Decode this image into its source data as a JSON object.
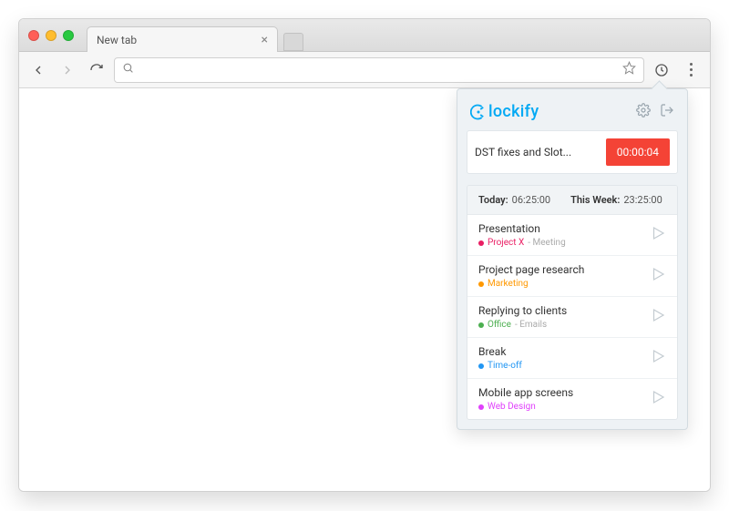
{
  "browser": {
    "tab_title": "New tab",
    "omnibox_value": ""
  },
  "popup": {
    "brand": "lockify",
    "current": {
      "title": "DST fixes and Slot...",
      "timer": "00:00:04"
    },
    "summary": {
      "today_label": "Today:",
      "today_value": "06:25:00",
      "week_label": "This Week:",
      "week_value": "23:25:00"
    },
    "entries": [
      {
        "title": "Presentation",
        "project": "Project X",
        "color": "#e91e63",
        "task": "Meeting"
      },
      {
        "title": "Project page research",
        "project": "Marketing",
        "color": "#ff9800",
        "task": ""
      },
      {
        "title": "Replying to clients",
        "project": "Office",
        "color": "#4caf50",
        "task": "Emails"
      },
      {
        "title": "Break",
        "project": "Time-off",
        "color": "#2196f3",
        "task": ""
      },
      {
        "title": "Mobile app screens",
        "project": "Web Design",
        "color": "#e040fb",
        "task": ""
      }
    ]
  }
}
